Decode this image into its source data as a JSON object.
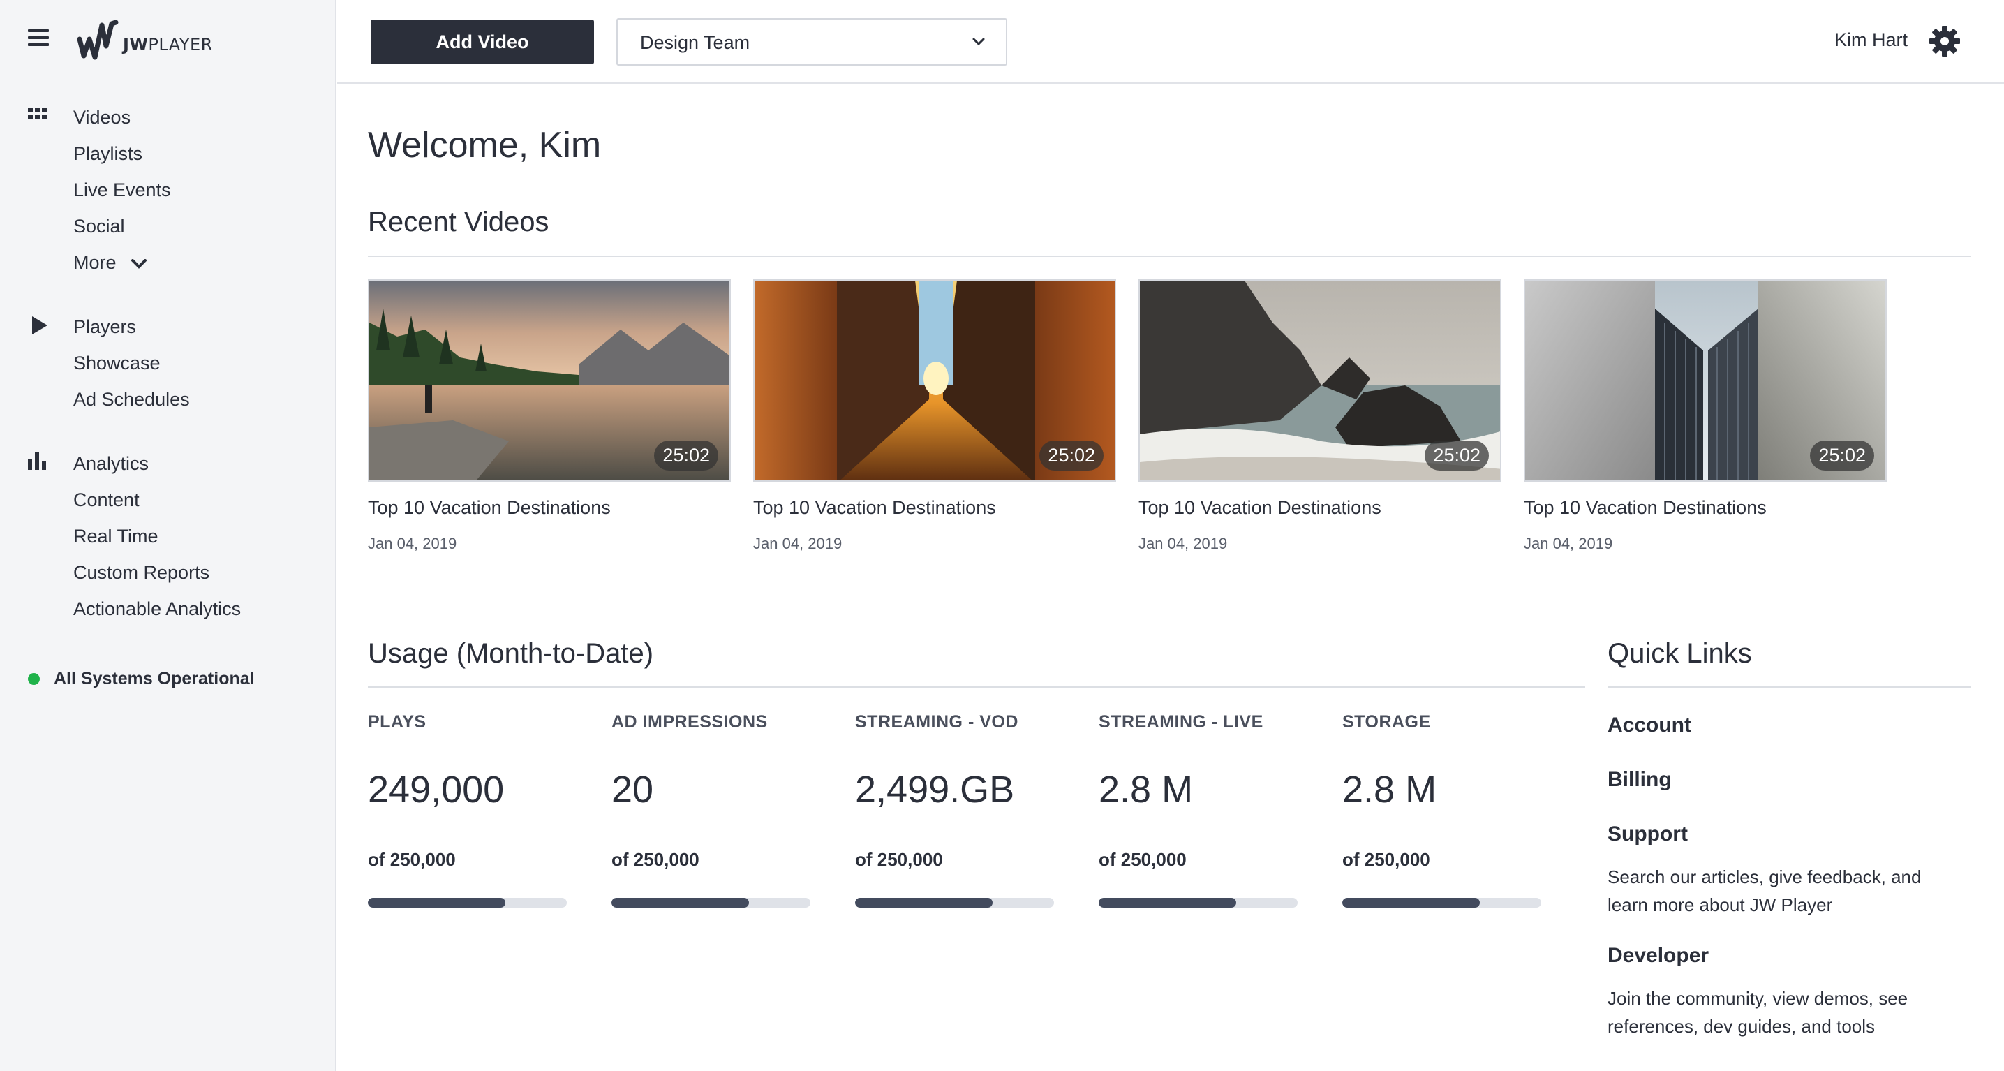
{
  "app": {
    "logo_prefix": "JW",
    "logo_suffix": "PLAYER"
  },
  "sidebar": {
    "groups": [
      {
        "icon": "grid-icon",
        "items": [
          "Videos",
          "Playlists",
          "Live Events",
          "Social",
          "More"
        ]
      },
      {
        "icon": "play-icon",
        "items": [
          "Players",
          "Showcase",
          "Ad Schedules"
        ]
      },
      {
        "icon": "bar-chart-icon",
        "items": [
          "Analytics",
          "Content",
          "Real Time",
          "Custom Reports",
          "Actionable Analytics"
        ]
      }
    ],
    "status": {
      "text": "All Systems Operational",
      "color": "#1fb24a"
    }
  },
  "topbar": {
    "add_video_label": "Add Video",
    "team_select": "Design Team",
    "user_name": "Kim Hart"
  },
  "main": {
    "welcome": "Welcome, Kim",
    "recent_title": "Recent Videos",
    "videos": [
      {
        "title": "Top 10 Vacation Destinations",
        "date": "Jan 04, 2019",
        "duration": "25:02",
        "thumb": "mountain-lake"
      },
      {
        "title": "Top 10 Vacation Destinations",
        "date": "Jan 04, 2019",
        "duration": "25:02",
        "thumb": "sunset-street"
      },
      {
        "title": "Top 10 Vacation Destinations",
        "date": "Jan 04, 2019",
        "duration": "25:02",
        "thumb": "ocean-rocks"
      },
      {
        "title": "Top 10 Vacation Destinations",
        "date": "Jan 04, 2019",
        "duration": "25:02",
        "thumb": "skyscraper"
      }
    ],
    "usage_title": "Usage (Month-to-Date)",
    "metrics": [
      {
        "label": "PLAYS",
        "value": "249,000",
        "of": "of 250,000",
        "fill": 0.69
      },
      {
        "label": "AD IMPRESSIONS",
        "value": "20",
        "of": "of 250,000",
        "fill": 0.69
      },
      {
        "label": "STREAMING - VOD",
        "value": "2,499.GB",
        "of": "of 250,000",
        "fill": 0.69
      },
      {
        "label": "STREAMING - LIVE",
        "value": "2.8 M",
        "of": "of 250,000",
        "fill": 0.69
      },
      {
        "label": "STORAGE",
        "value": "2.8 M",
        "of": "of 250,000",
        "fill": 0.69
      }
    ],
    "quick_links_title": "Quick Links",
    "quick_links": [
      {
        "label": "Account"
      },
      {
        "label": "Billing"
      },
      {
        "label": "Support",
        "desc": "Search our articles, give feedback, and learn more about JW Player"
      },
      {
        "label": "Developer",
        "desc": "Join the community, view demos, see references, dev guides, and tools"
      }
    ]
  },
  "colors": {
    "accent": "#2b2f3a",
    "bar_fill": "#434b5e",
    "bar_track": "#dfe2e8",
    "sidebar_bg": "#f4f5f7"
  }
}
